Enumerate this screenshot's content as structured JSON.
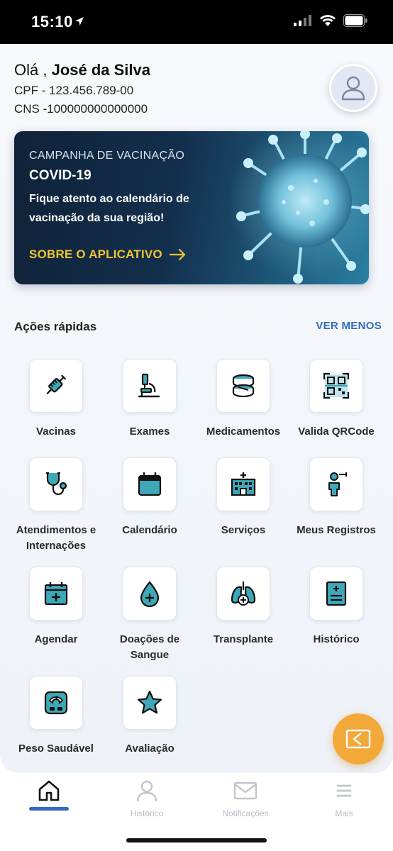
{
  "status_bar": {
    "time": "15:10"
  },
  "user": {
    "greeting_prefix": "Olá ,",
    "name": "José da Silva",
    "cpf": "CPF - 123.456.789-00",
    "cns": "CNS -100000000000000"
  },
  "banner": {
    "kicker": "CAMPANHA DE VACINAÇÃO",
    "title": "COVID-19",
    "text": "Fique atento ao calendário de vacinação da sua região!",
    "link": "SOBRE O APLICATIVO"
  },
  "quick_actions": {
    "title": "Ações rápidas",
    "toggle": "VER MENOS",
    "items": [
      {
        "label": "Vacinas",
        "icon": "syringe-icon"
      },
      {
        "label": "Exames",
        "icon": "microscope-icon"
      },
      {
        "label": "Medicamentos",
        "icon": "pills-icon"
      },
      {
        "label": "Valida QRCode",
        "icon": "qrcode-icon"
      },
      {
        "label": "Atendimentos e Internações",
        "icon": "stethoscope-icon"
      },
      {
        "label": "Calendário",
        "icon": "calendar-icon"
      },
      {
        "label": "Serviços",
        "icon": "hospital-icon"
      },
      {
        "label": "Meus Registros",
        "icon": "person-record-icon"
      },
      {
        "label": "Agendar",
        "icon": "calendar-plus-icon"
      },
      {
        "label": "Doações de Sangue",
        "icon": "blood-drop-icon"
      },
      {
        "label": "Transplante",
        "icon": "lungs-icon"
      },
      {
        "label": "Histórico",
        "icon": "document-icon"
      },
      {
        "label": "Peso Saudável",
        "icon": "scale-icon"
      },
      {
        "label": "Avaliação",
        "icon": "star-icon"
      }
    ]
  },
  "tabs": [
    {
      "label": "",
      "icon": "home-icon",
      "active": true
    },
    {
      "label": "Histórico",
      "icon": "person-icon"
    },
    {
      "label": "Notificações",
      "icon": "mail-icon"
    },
    {
      "label": "Mais",
      "icon": "menu-icon"
    }
  ],
  "colors": {
    "accent": "#2f6bbf",
    "teal": "#3fa8b8",
    "fab": "#f3a83a",
    "link": "#f2c530"
  }
}
